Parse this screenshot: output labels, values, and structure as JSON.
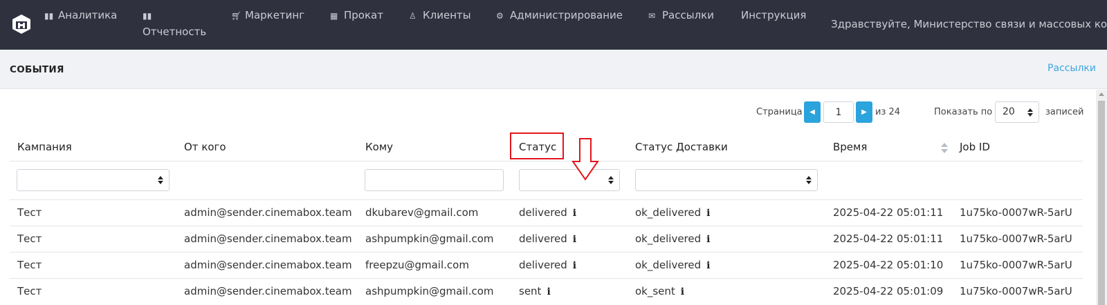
{
  "nav": {
    "items": [
      {
        "label": "Аналитика",
        "icon": "bar-chart-icon"
      },
      {
        "label": "Отчетность",
        "icon": "bar-chart-icon"
      },
      {
        "label": "Маркетинг",
        "icon": "cart-icon"
      },
      {
        "label": "Прокат",
        "icon": "film-icon"
      },
      {
        "label": "Клиенты",
        "icon": "user-icon"
      },
      {
        "label": "Администрирование",
        "icon": "gears-icon"
      },
      {
        "label": "Рассылки",
        "icon": "envelope-icon"
      },
      {
        "label": "Инструкция",
        "icon": ""
      }
    ],
    "greeting": "Здравствуйте, Министерство связи и массовых ком"
  },
  "header": {
    "title": "СОБЫТИЯ",
    "link": "Рассылки"
  },
  "pagination": {
    "page_label": "Страница",
    "page_value": "1",
    "of_label": "из 24",
    "show_label": "Показать по",
    "per_page": "20",
    "records_label": "записей"
  },
  "table": {
    "columns": [
      "Кампания",
      "От кого",
      "Кому",
      "Статус",
      "Статус Доставки",
      "Время",
      "Job ID"
    ],
    "rows": [
      {
        "campaign": "Тест",
        "from": "admin@sender.cinemabox.team",
        "to": "dkubarev@gmail.com",
        "status": "delivered",
        "delivery": "ok_delivered",
        "time": "2025-04-22 05:01:11",
        "job": "1u75ko-0007wR-5arU"
      },
      {
        "campaign": "Тест",
        "from": "admin@sender.cinemabox.team",
        "to": "ashpumpkin@gmail.com",
        "status": "delivered",
        "delivery": "ok_delivered",
        "time": "2025-04-22 05:01:11",
        "job": "1u75ko-0007wR-5arU"
      },
      {
        "campaign": "Тест",
        "from": "admin@sender.cinemabox.team",
        "to": "freepzu@gmail.com",
        "status": "delivered",
        "delivery": "ok_delivered",
        "time": "2025-04-22 05:01:10",
        "job": "1u75ko-0007wR-5arU"
      },
      {
        "campaign": "Тест",
        "from": "admin@sender.cinemabox.team",
        "to": "ashpumpkin@gmail.com",
        "status": "sent",
        "delivery": "ok_sent",
        "time": "2025-04-22 05:01:09",
        "job": "1u75ko-0007wR-5arU"
      }
    ]
  },
  "colors": {
    "nav_bg": "#2f323e",
    "accent": "#2ba3dc",
    "annotation": "#e0161c"
  }
}
